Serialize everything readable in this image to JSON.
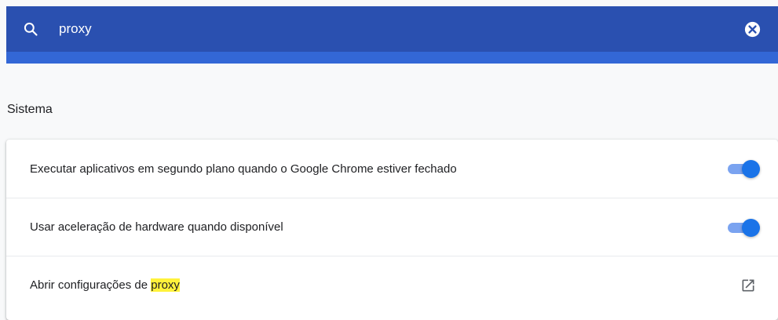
{
  "search": {
    "value": "proxy",
    "icon": "search-icon",
    "clear_icon": "clear-icon"
  },
  "section": {
    "title": "Sistema"
  },
  "settings": [
    {
      "label": "Executar aplicativos em segundo plano quando o Google Chrome estiver fechado",
      "control": "toggle",
      "checked": true
    },
    {
      "label": "Usar aceleração de hardware quando disponível",
      "control": "toggle",
      "checked": true
    },
    {
      "label_prefix": "Abrir configurações de ",
      "label_highlight": "proxy",
      "control": "external-link",
      "icon": "open-in-new-icon"
    }
  ],
  "colors": {
    "header": "#2a50b0",
    "header_band": "#3367d6",
    "accent": "#1a73e8",
    "highlight": "#fff23b"
  }
}
